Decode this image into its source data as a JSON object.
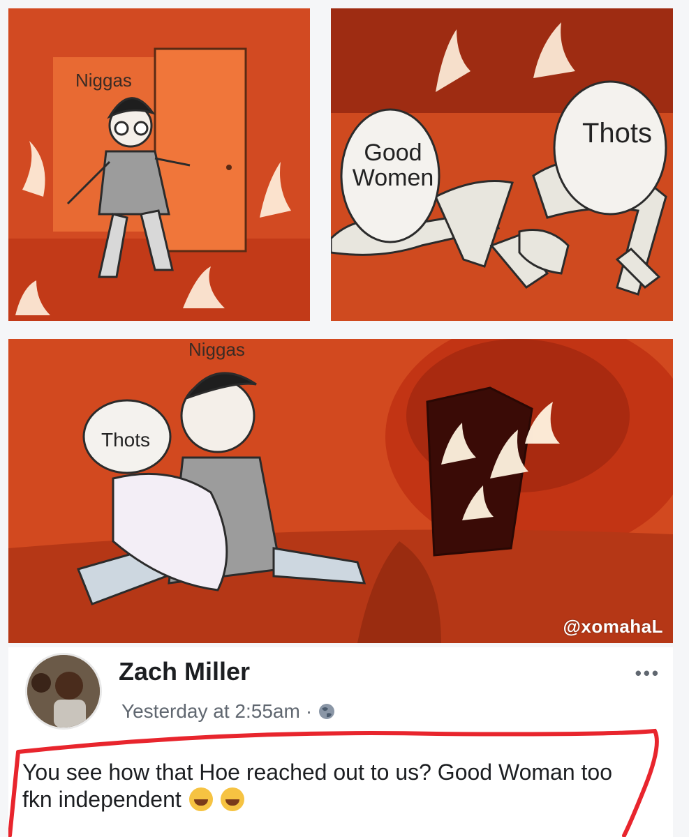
{
  "panels": {
    "top_left": {
      "label": "Niggas"
    },
    "top_right": {
      "bubble_left": "Good\nWomen",
      "bubble_right": "Thots"
    },
    "bottom": {
      "label": "Niggas",
      "bubble": "Thots",
      "watermark": "@xomahaL"
    }
  },
  "post": {
    "author": "Zach Miller",
    "timestamp": "Yesterday at 2:55am",
    "separator": "·",
    "caption": "You see how that Hoe reached out to us? Good Woman too fkn independent",
    "emojis": [
      "sneezing-face-icon",
      "rolling-laughing-icon"
    ],
    "more_label": "•••"
  },
  "colors": {
    "fire": "#d9481f",
    "highlight": "#e8252d"
  }
}
